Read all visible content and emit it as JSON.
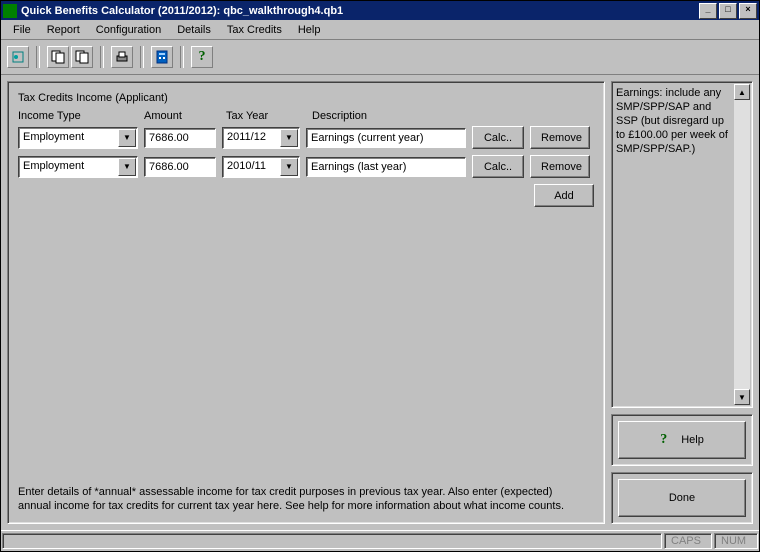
{
  "title": "Quick Benefits Calculator (2011/2012): qbc_walkthrough4.qb1",
  "menu": {
    "file": "File",
    "report": "Report",
    "configuration": "Configuration",
    "details": "Details",
    "tax_credits": "Tax Credits",
    "help": "Help"
  },
  "section_title": "Tax Credits Income (Applicant)",
  "headers": {
    "income_type": "Income Type",
    "amount": "Amount",
    "tax_year": "Tax Year",
    "description": "Description"
  },
  "rows": [
    {
      "income_type": "Employment",
      "amount": "7686.00",
      "tax_year": "2011/12",
      "description": "Earnings (current year)"
    },
    {
      "income_type": "Employment",
      "amount": "7686.00",
      "tax_year": "2010/11",
      "description": "Earnings (last year)"
    }
  ],
  "buttons": {
    "calc": "Calc..",
    "remove": "Remove",
    "add": "Add",
    "help": "Help",
    "done": "Done"
  },
  "info_text": "Earnings: include any SMP/SPP/SAP and SSP (but disregard up to £100.00 per week of SMP/SPP/SAP.)",
  "footer_text": "Enter details of *annual* assessable income for tax credit purposes in previous tax year. Also enter (expected) annual income for tax credits for current tax year here. See help for more information about what income counts.",
  "status": {
    "caps": "CAPS",
    "num": "NUM"
  }
}
